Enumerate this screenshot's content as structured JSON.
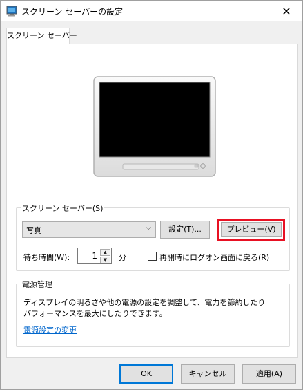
{
  "window": {
    "title": "スクリーン セーバーの設定",
    "close_glyph": "✕"
  },
  "tab": {
    "label": "スクリーン セーバー"
  },
  "screensaver_group": {
    "label": "スクリーン セーバー(S)",
    "selected": "写真",
    "settings_button": "設定(T)...",
    "preview_button": "プレビュー(V)",
    "wait_label": "待ち時間(W):",
    "wait_value": "1",
    "wait_unit": "分",
    "resume_logon_label": "再開時にログオン画面に戻る(R)",
    "resume_logon_checked": false
  },
  "power_group": {
    "label": "電源管理",
    "description_line1": "ディスプレイの明るさや他の電源の設定を調整して、電力を節約したり",
    "description_line2": "パフォーマンスを最大にしたりできます。",
    "link": "電源設定の変更"
  },
  "footer": {
    "ok": "OK",
    "cancel": "キャンセル",
    "apply": "適用(A)"
  },
  "colors": {
    "highlight": "#e81123",
    "link": "#0066cc",
    "accent": "#0078d7"
  },
  "icons": {
    "title": "screensaver-monitor-icon",
    "close": "close-icon",
    "combo": "chevron-down-icon",
    "spin_up": "arrow-up-icon",
    "spin_down": "arrow-down-icon"
  }
}
